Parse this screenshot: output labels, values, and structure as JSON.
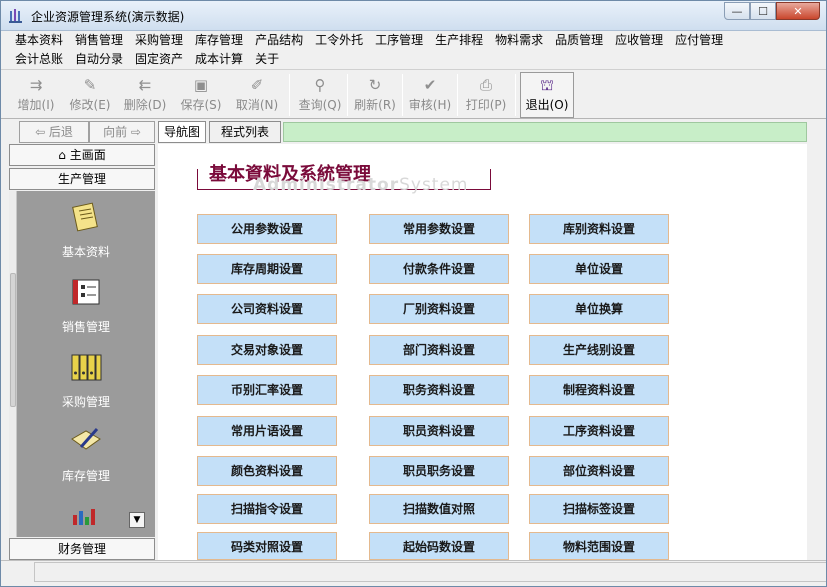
{
  "window": {
    "title": "企业资源管理系统(演示数据)",
    "controls": {
      "minimize": "—",
      "maximize": "☐",
      "close": "✕"
    }
  },
  "menu": {
    "row1": [
      "基本资料",
      "销售管理",
      "采购管理",
      "库存管理",
      "产品结构",
      "工令外托",
      "工序管理",
      "生产排程",
      "物料需求",
      "品质管理",
      "应收管理",
      "应付管理"
    ],
    "row2": [
      "会计总账",
      "自动分录",
      "固定资产",
      "成本计算",
      "关于"
    ]
  },
  "toolbar": {
    "add": "增加(I)",
    "edit": "修改(E)",
    "delete": "删除(D)",
    "save": "保存(S)",
    "cancel": "取消(N)",
    "query": "查询(Q)",
    "refresh": "刷新(R)",
    "audit": "审核(H)",
    "print": "打印(P)",
    "exit": "退出(O)"
  },
  "nav": {
    "back": "⇦ 后退",
    "forward": "向前 ⇨"
  },
  "tabs": {
    "nav_map": "导航图",
    "program_list": "程式列表"
  },
  "sidebar": {
    "home": "主画面",
    "production": "生产管理",
    "items": [
      "基本资料",
      "销售管理",
      "采购管理",
      "库存管理"
    ],
    "finance": "财务管理"
  },
  "content": {
    "banner_title": "基本資料及系統管理",
    "banner_sub_bold": "Administrator",
    "banner_sub_light": "System",
    "buttons": [
      [
        "公用参数设置",
        "常用参数设置",
        "库别资料设置"
      ],
      [
        "库存周期设置",
        "付款条件设置",
        "单位设置"
      ],
      [
        "公司资料设置",
        "厂别资料设置",
        "单位换算"
      ],
      [
        "交易对象设置",
        "部门资料设置",
        "生产线别设置"
      ],
      [
        "币别汇率设置",
        "职务资料设置",
        "制程资料设置"
      ],
      [
        "常用片语设置",
        "职员资料设置",
        "工序资料设置"
      ],
      [
        "颜色资料设置",
        "职员职务设置",
        "部位资料设置"
      ],
      [
        "扫描指令设置",
        "扫描数值对照",
        "扫描标签设置"
      ],
      [
        "码类对照设置",
        "起始码数设置",
        "物料范围设置"
      ]
    ]
  }
}
